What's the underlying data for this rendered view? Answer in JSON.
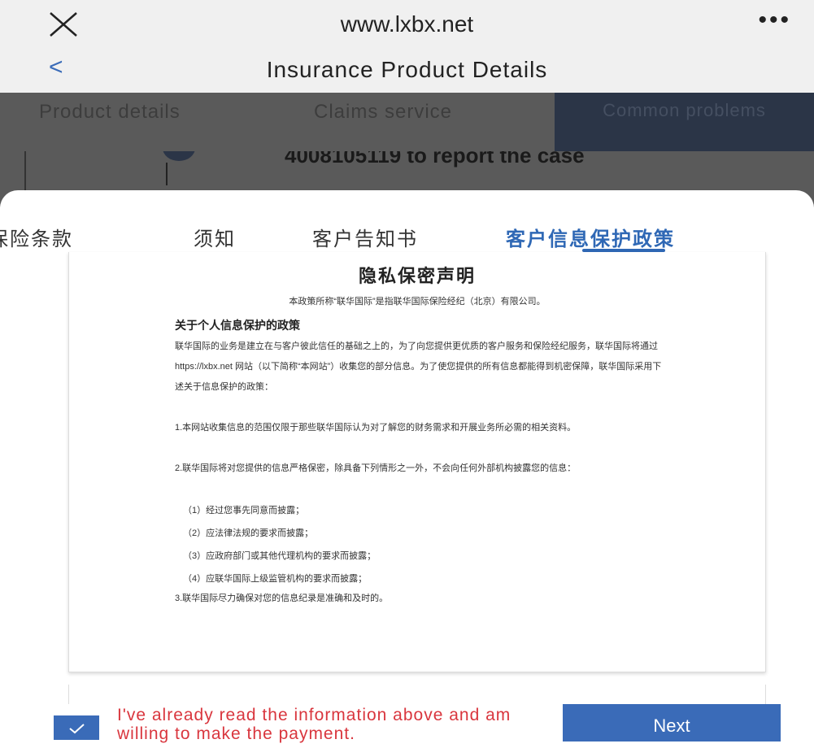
{
  "browser": {
    "url": "www.lxbx.net",
    "more_label": "•••"
  },
  "nav": {
    "back_label": "<",
    "title": "Insurance Product Details"
  },
  "product_tabs": [
    "Product details",
    "Claims service",
    "Common problems"
  ],
  "behind_text": "4008105119 to report the case",
  "sheet_tabs": [
    "保险条款",
    "须知",
    "客户告知书",
    "客户信息保护政策"
  ],
  "doc": {
    "title": "隐私保密声明",
    "subtitle": "本政策所称“联华国际”是指联华国际保险经纪（北京）有限公司。",
    "heading": "关于个人信息保护的政策",
    "intro": "联华国际的业务是建立在与客户彼此信任的基础之上的，为了向您提供更优质的客户服务和保险经纪服务，联华国际将通过 https://lxbx.net 网站（以下简称“本网站”）收集您的部分信息。为了使您提供的所有信息都能得到机密保障，联华国际采用下述关于信息保护的政策：",
    "p1": "1.本网站收集信息的范围仅限于那些联华国际认为对了解您的财务需求和开展业务所必需的相关资料。",
    "p2": "2.联华国际将对您提供的信息严格保密，除具备下列情形之一外，不会向任何外部机构披露您的信息：",
    "items": [
      "（1）经过您事先同意而披露；",
      "（2）应法律法规的要求而披露；",
      "（3）应政府部门或其他代理机构的要求而披露；",
      "（4）应联华国际上级监管机构的要求而披露；"
    ],
    "p3": "3.联华国际尽力确保对您的信息纪录是准确和及时的。"
  },
  "footer": {
    "agree_text": "I've already read the information above and am willing to make the payment.",
    "next_label": "Next"
  },
  "colors": {
    "accent": "#3a6bb8",
    "agree_text": "#d9363e",
    "overlay": "#5a5a5a"
  }
}
